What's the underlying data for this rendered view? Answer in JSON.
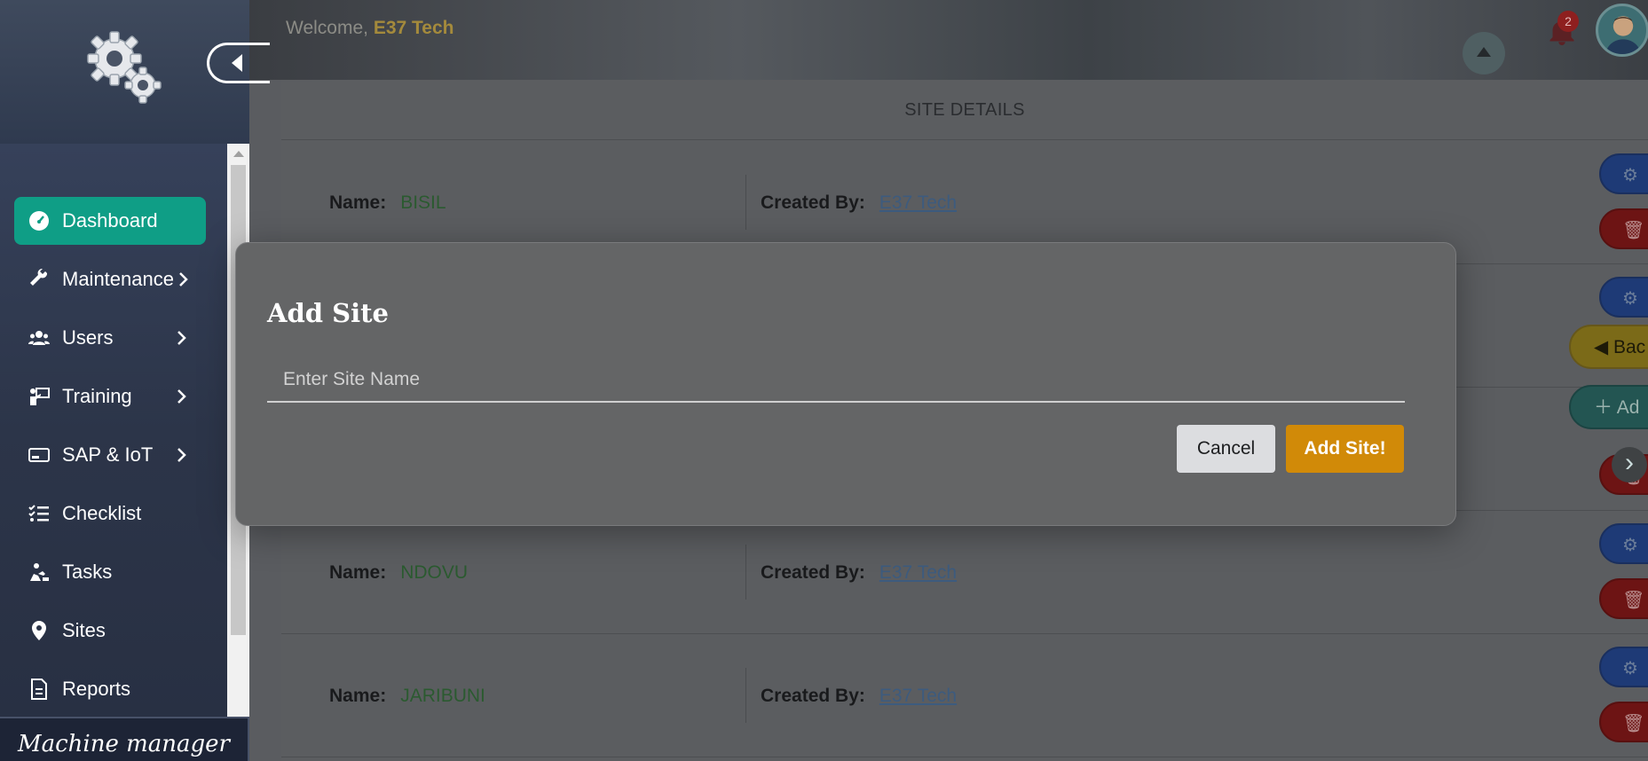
{
  "header": {
    "welcome_prefix": "Welcome, ",
    "user_name": "E37 Tech",
    "notification_count": "2",
    "icons": [
      "bell-icon",
      "avatar",
      "scroll-up-icon"
    ]
  },
  "sidebar": {
    "icons": {
      "logo": "gears-logo-icon",
      "collapse": "caret-left-icon"
    },
    "items": [
      {
        "label": "Dashboard",
        "icon": "gauge-icon",
        "has_submenu": false,
        "active": true
      },
      {
        "label": "Maintenance",
        "icon": "wrench-icon",
        "has_submenu": true
      },
      {
        "label": "Users",
        "icon": "users-icon",
        "has_submenu": true
      },
      {
        "label": "Training",
        "icon": "teacher-icon",
        "has_submenu": true
      },
      {
        "label": "SAP & IoT",
        "icon": "card-icon",
        "has_submenu": true
      },
      {
        "label": "Checklist",
        "icon": "checklist-icon",
        "has_submenu": false
      },
      {
        "label": "Tasks",
        "icon": "worker-icon",
        "has_submenu": false
      },
      {
        "label": "Sites",
        "icon": "map-pin-icon",
        "has_submenu": false
      },
      {
        "label": "Reports",
        "icon": "document-icon",
        "has_submenu": false
      }
    ],
    "brand": "Machine manager"
  },
  "card": {
    "title": "SITE DETAILS",
    "name_label": "Name:",
    "created_label": "Created By:",
    "rows": [
      {
        "name": "BISIL",
        "created_by": "E37 Tech"
      },
      {
        "name": "",
        "created_by": ""
      },
      {
        "name": "",
        "created_by": ""
      },
      {
        "name": "NDOVU",
        "created_by": "E37 Tech"
      },
      {
        "name": "JARIBUNI",
        "created_by": "E37 Tech"
      }
    ],
    "side_buttons": {
      "back": "Bac",
      "add": "Ad"
    }
  },
  "modal": {
    "title": "Add Site",
    "input_placeholder": "Enter Site Name",
    "input_value": "",
    "cancel_label": "Cancel",
    "submit_label": "Add Site!"
  },
  "colors": {
    "accent_active": "#0f9e86",
    "submit_button": "#d18a08",
    "name_value": "#2b5a30",
    "link": "#3d5b7e"
  }
}
